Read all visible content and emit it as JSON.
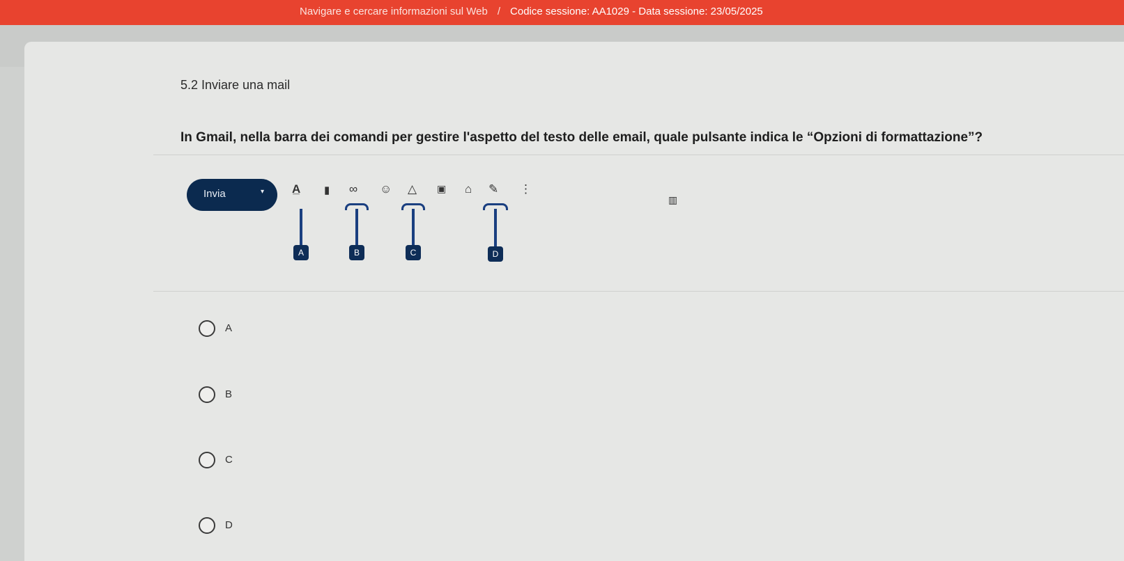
{
  "header": {
    "breadcrumb": "Navigare e cercare informazioni sul Web",
    "separator": "/",
    "session": "Codice sessione: AA1029 - Data sessione: 23/05/2025"
  },
  "section_title": "5.2 Inviare una mail",
  "question": "In Gmail, nella barra dei comandi per gestire l'aspetto del testo delle email, quale pulsante indica le “Opzioni di formattazione”?",
  "toolbar": {
    "send_label": "Invia",
    "dropdown_glyph": "▾",
    "icons": [
      {
        "name": "format-text-icon",
        "glyph": "A̲"
      },
      {
        "name": "attachment-icon",
        "glyph": "▮"
      },
      {
        "name": "link-icon",
        "glyph": "∞"
      },
      {
        "name": "emoji-icon",
        "glyph": "☺"
      },
      {
        "name": "drive-icon",
        "glyph": "△"
      },
      {
        "name": "photo-icon",
        "glyph": "▣"
      },
      {
        "name": "confidential-lock-icon",
        "glyph": "⌂"
      },
      {
        "name": "signature-pen-icon",
        "glyph": "✎"
      },
      {
        "name": "more-options-icon",
        "glyph": "⋮"
      },
      {
        "name": "discard-trash-icon",
        "glyph": "▥"
      }
    ]
  },
  "callouts": [
    "A",
    "B",
    "C",
    "D"
  ],
  "options": [
    "A",
    "B",
    "C",
    "D"
  ],
  "colors": {
    "header_red": "#e8432f",
    "send_button": "#0b2a4f",
    "callout_blue": "#1a3f80"
  }
}
